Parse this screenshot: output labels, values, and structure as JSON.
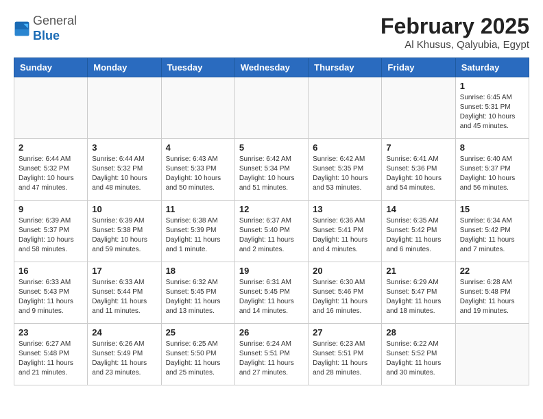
{
  "header": {
    "logo_general": "General",
    "logo_blue": "Blue",
    "title": "February 2025",
    "subtitle": "Al Khusus, Qalyubia, Egypt"
  },
  "days_of_week": [
    "Sunday",
    "Monday",
    "Tuesday",
    "Wednesday",
    "Thursday",
    "Friday",
    "Saturday"
  ],
  "weeks": [
    [
      {
        "day": "",
        "info": ""
      },
      {
        "day": "",
        "info": ""
      },
      {
        "day": "",
        "info": ""
      },
      {
        "day": "",
        "info": ""
      },
      {
        "day": "",
        "info": ""
      },
      {
        "day": "",
        "info": ""
      },
      {
        "day": "1",
        "info": "Sunrise: 6:45 AM\nSunset: 5:31 PM\nDaylight: 10 hours and 45 minutes."
      }
    ],
    [
      {
        "day": "2",
        "info": "Sunrise: 6:44 AM\nSunset: 5:32 PM\nDaylight: 10 hours and 47 minutes."
      },
      {
        "day": "3",
        "info": "Sunrise: 6:44 AM\nSunset: 5:32 PM\nDaylight: 10 hours and 48 minutes."
      },
      {
        "day": "4",
        "info": "Sunrise: 6:43 AM\nSunset: 5:33 PM\nDaylight: 10 hours and 50 minutes."
      },
      {
        "day": "5",
        "info": "Sunrise: 6:42 AM\nSunset: 5:34 PM\nDaylight: 10 hours and 51 minutes."
      },
      {
        "day": "6",
        "info": "Sunrise: 6:42 AM\nSunset: 5:35 PM\nDaylight: 10 hours and 53 minutes."
      },
      {
        "day": "7",
        "info": "Sunrise: 6:41 AM\nSunset: 5:36 PM\nDaylight: 10 hours and 54 minutes."
      },
      {
        "day": "8",
        "info": "Sunrise: 6:40 AM\nSunset: 5:37 PM\nDaylight: 10 hours and 56 minutes."
      }
    ],
    [
      {
        "day": "9",
        "info": "Sunrise: 6:39 AM\nSunset: 5:37 PM\nDaylight: 10 hours and 58 minutes."
      },
      {
        "day": "10",
        "info": "Sunrise: 6:39 AM\nSunset: 5:38 PM\nDaylight: 10 hours and 59 minutes."
      },
      {
        "day": "11",
        "info": "Sunrise: 6:38 AM\nSunset: 5:39 PM\nDaylight: 11 hours and 1 minute."
      },
      {
        "day": "12",
        "info": "Sunrise: 6:37 AM\nSunset: 5:40 PM\nDaylight: 11 hours and 2 minutes."
      },
      {
        "day": "13",
        "info": "Sunrise: 6:36 AM\nSunset: 5:41 PM\nDaylight: 11 hours and 4 minutes."
      },
      {
        "day": "14",
        "info": "Sunrise: 6:35 AM\nSunset: 5:42 PM\nDaylight: 11 hours and 6 minutes."
      },
      {
        "day": "15",
        "info": "Sunrise: 6:34 AM\nSunset: 5:42 PM\nDaylight: 11 hours and 7 minutes."
      }
    ],
    [
      {
        "day": "16",
        "info": "Sunrise: 6:33 AM\nSunset: 5:43 PM\nDaylight: 11 hours and 9 minutes."
      },
      {
        "day": "17",
        "info": "Sunrise: 6:33 AM\nSunset: 5:44 PM\nDaylight: 11 hours and 11 minutes."
      },
      {
        "day": "18",
        "info": "Sunrise: 6:32 AM\nSunset: 5:45 PM\nDaylight: 11 hours and 13 minutes."
      },
      {
        "day": "19",
        "info": "Sunrise: 6:31 AM\nSunset: 5:45 PM\nDaylight: 11 hours and 14 minutes."
      },
      {
        "day": "20",
        "info": "Sunrise: 6:30 AM\nSunset: 5:46 PM\nDaylight: 11 hours and 16 minutes."
      },
      {
        "day": "21",
        "info": "Sunrise: 6:29 AM\nSunset: 5:47 PM\nDaylight: 11 hours and 18 minutes."
      },
      {
        "day": "22",
        "info": "Sunrise: 6:28 AM\nSunset: 5:48 PM\nDaylight: 11 hours and 19 minutes."
      }
    ],
    [
      {
        "day": "23",
        "info": "Sunrise: 6:27 AM\nSunset: 5:48 PM\nDaylight: 11 hours and 21 minutes."
      },
      {
        "day": "24",
        "info": "Sunrise: 6:26 AM\nSunset: 5:49 PM\nDaylight: 11 hours and 23 minutes."
      },
      {
        "day": "25",
        "info": "Sunrise: 6:25 AM\nSunset: 5:50 PM\nDaylight: 11 hours and 25 minutes."
      },
      {
        "day": "26",
        "info": "Sunrise: 6:24 AM\nSunset: 5:51 PM\nDaylight: 11 hours and 27 minutes."
      },
      {
        "day": "27",
        "info": "Sunrise: 6:23 AM\nSunset: 5:51 PM\nDaylight: 11 hours and 28 minutes."
      },
      {
        "day": "28",
        "info": "Sunrise: 6:22 AM\nSunset: 5:52 PM\nDaylight: 11 hours and 30 minutes."
      },
      {
        "day": "",
        "info": ""
      }
    ]
  ]
}
